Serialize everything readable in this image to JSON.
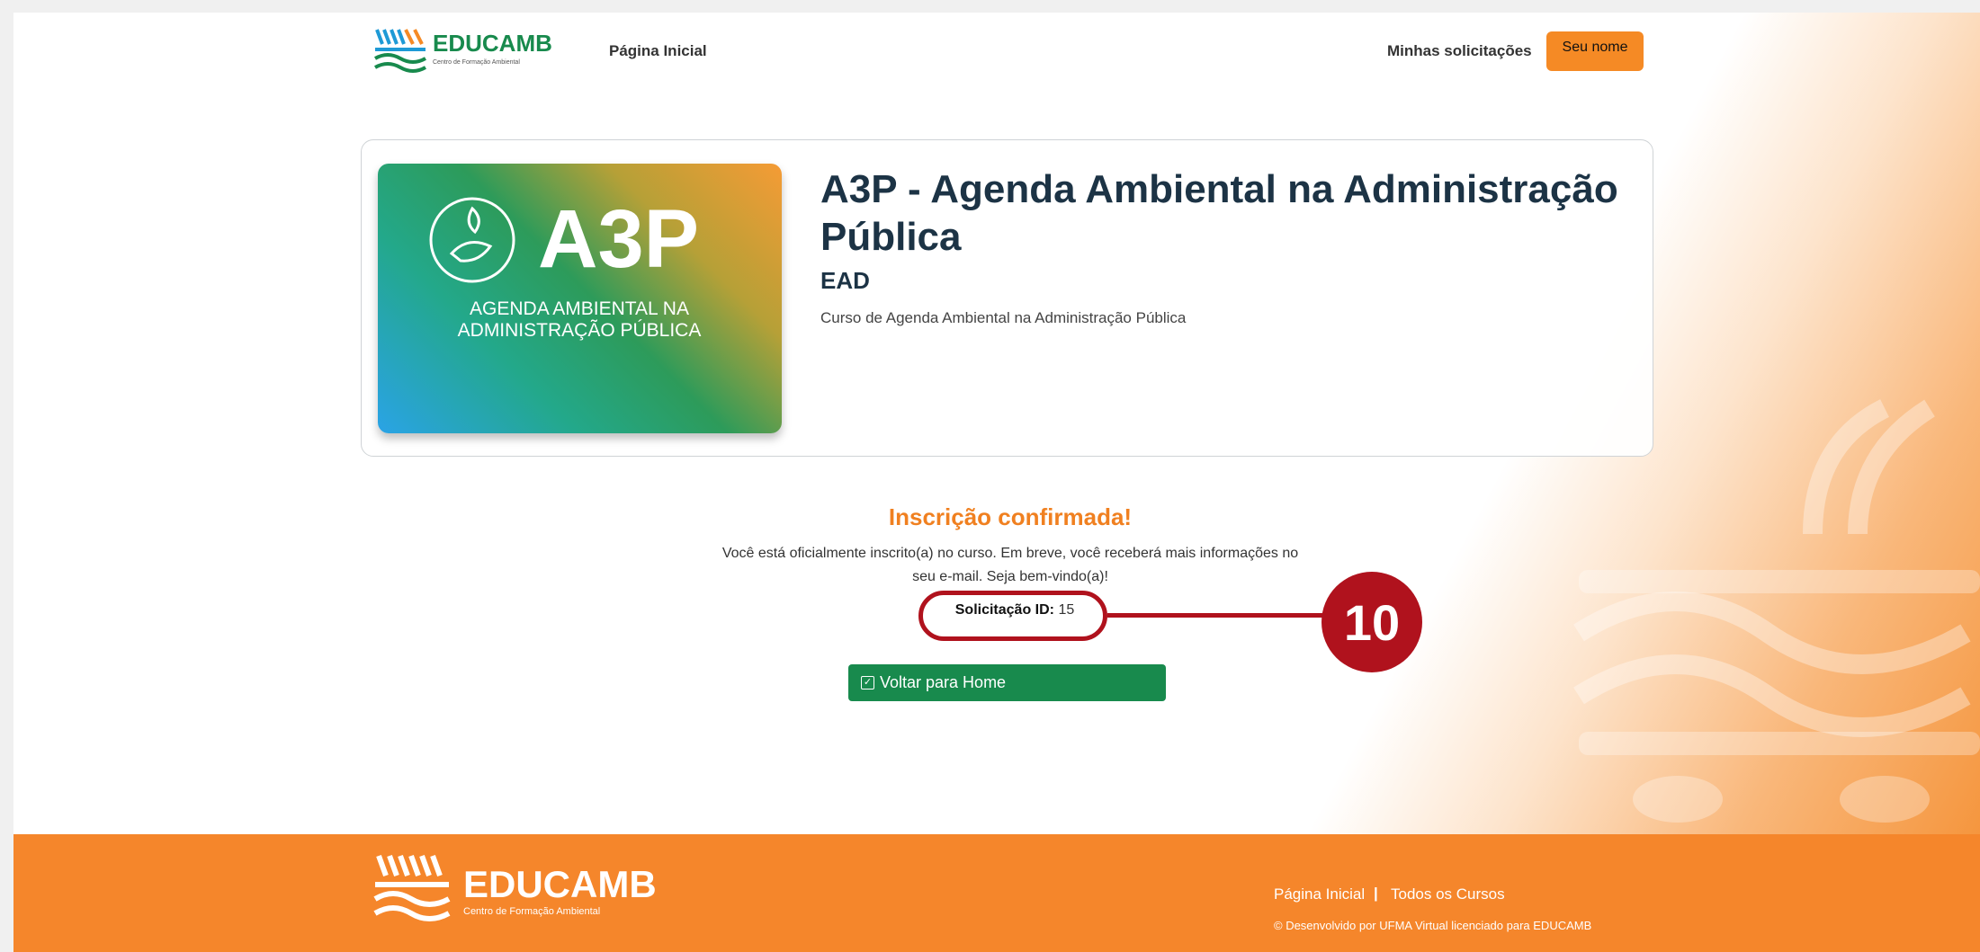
{
  "brand": {
    "name": "EDUCAMB",
    "tagline": "Centro de Formação Ambiental"
  },
  "nav": {
    "home": "Página Inicial",
    "requests": "Minhas solicitações",
    "user": "Seu nome"
  },
  "course": {
    "badge_text": "A3P",
    "badge_caption_1": "AGENDA AMBIENTAL NA",
    "badge_caption_2": "ADMINISTRAÇÃO PÚBLICA",
    "title": "A3P - Agenda Ambiental na Administração Pública",
    "modality": "EAD",
    "description": "Curso de Agenda Ambiental na Administração Pública"
  },
  "confirmation": {
    "title": "Inscrição confirmada!",
    "message_line1": "Você está oficialmente inscrito(a) no curso. Em breve, você receberá mais informações no",
    "message_line2": "seu e-mail. Seja bem-vindo(a)!",
    "request_label": "Solicitação ID:",
    "request_value": "15",
    "home_button": "Voltar para Home"
  },
  "annotation": {
    "step_number": "10"
  },
  "footer": {
    "home": "Página Inicial",
    "separator": "|",
    "courses": "Todos os Cursos",
    "copyright": "© Desenvolvido por UFMA Virtual licenciado para EDUCAMB"
  },
  "colors": {
    "accent_orange": "#f5862b",
    "brand_green": "#188a4d",
    "annotation_red": "#b0121d",
    "title_navy": "#1c3345"
  }
}
